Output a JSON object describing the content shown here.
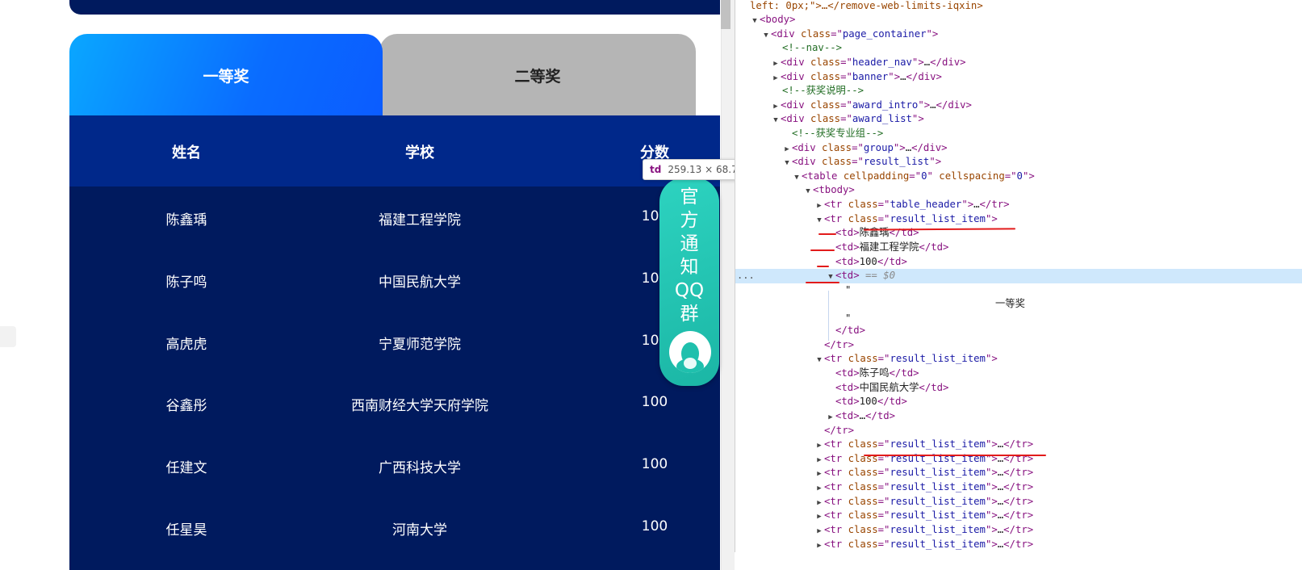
{
  "tabs": [
    {
      "label": "一等奖"
    },
    {
      "label": "二等奖"
    }
  ],
  "table": {
    "headers": [
      "姓名",
      "学校",
      "分数"
    ],
    "rows": [
      {
        "name": "陈鑫瑀",
        "school": "福建工程学院",
        "score": "100"
      },
      {
        "name": "陈子鸣",
        "school": "中国民航大学",
        "score": "100"
      },
      {
        "name": "高虎虎",
        "school": "宁夏师范学院",
        "score": "100"
      },
      {
        "name": "谷鑫彤",
        "school": "西南财经大学天府学院",
        "score": "100"
      },
      {
        "name": "任建文",
        "school": "广西科技大学",
        "score": "100"
      },
      {
        "name": "任星昊",
        "school": "河南大学",
        "score": "100"
      }
    ]
  },
  "qq_widget": {
    "chars": [
      "官",
      "方",
      "通",
      "知",
      "QQ",
      "群"
    ],
    "icon": "qq-penguin-icon"
  },
  "tooltip": {
    "tag": "td",
    "size": "259.13 × 68.7"
  },
  "devtools": {
    "line_top": "left: 0px;\">…</remove-web-limits-iqxin>",
    "body_tag": "body",
    "page_container": "page_container",
    "nav_comment": "<!--nav-->",
    "header_nav": "header_nav",
    "banner": "banner",
    "award_comment": "<!--获奖说明-->",
    "award_intro": "award_intro",
    "award_list": "award_list",
    "group_comment": "<!--获奖专业组-->",
    "group": "group",
    "result_list": "result_list",
    "cellpadding": "0",
    "cellspacing": "0",
    "table_header": "table_header",
    "result_list_item": "result_list_item",
    "td1": "陈鑫瑀",
    "td2": "福建工程学院",
    "td3": "100",
    "selected_marker": "== $0",
    "quote": "\"",
    "td_text": "一等奖",
    "row2_td1": "陈子鸣",
    "row2_td2": "中国民航大学",
    "row2_td3": "100",
    "ellipsis": "…",
    "more_dots": "..."
  }
}
